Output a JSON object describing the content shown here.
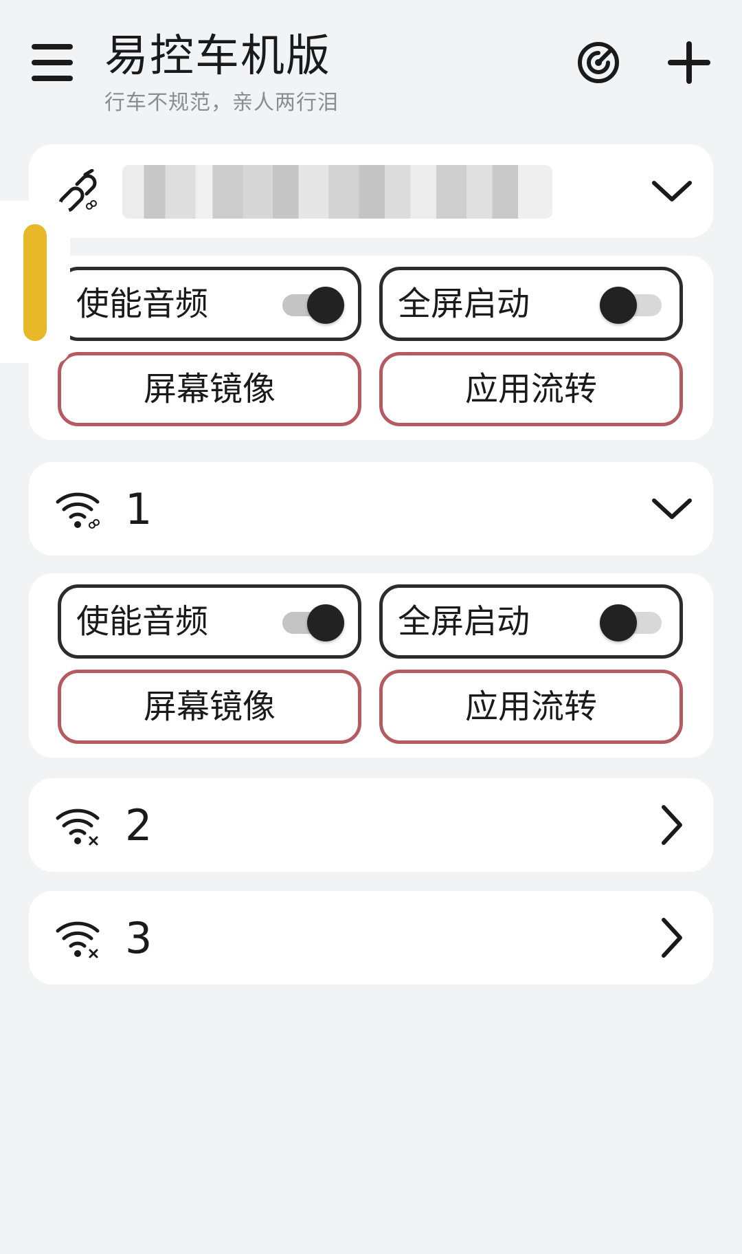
{
  "header": {
    "title": "易控车机版",
    "subtitle": "行车不规范，亲人两行泪",
    "menu_icon": "menu-icon",
    "scan_icon": "radar-scan-icon",
    "add_icon": "plus-icon"
  },
  "devices": [
    {
      "name": "",
      "connection_icon": "usb-link-icon",
      "expanded": true,
      "audio_label": "使能音频",
      "audio_enabled": true,
      "fullscreen_label": "全屏启动",
      "fullscreen_enabled": false,
      "mirror_label": "屏幕镜像",
      "transfer_label": "应用流转"
    },
    {
      "name": "1",
      "connection_icon": "wifi-link-icon",
      "expanded": true,
      "audio_label": "使能音频",
      "audio_enabled": true,
      "fullscreen_label": "全屏启动",
      "fullscreen_enabled": false,
      "mirror_label": "屏幕镜像",
      "transfer_label": "应用流转"
    },
    {
      "name": "2",
      "connection_icon": "wifi-disconnected-icon",
      "expanded": false
    },
    {
      "name": "3",
      "connection_icon": "wifi-disconnected-icon",
      "expanded": false
    }
  ],
  "colors": {
    "background": "#f2f3f5",
    "card": "#ffffff",
    "toggle_border": "#2c2c2c",
    "action_border": "#b65a62",
    "side_handle": "#e8b828"
  }
}
